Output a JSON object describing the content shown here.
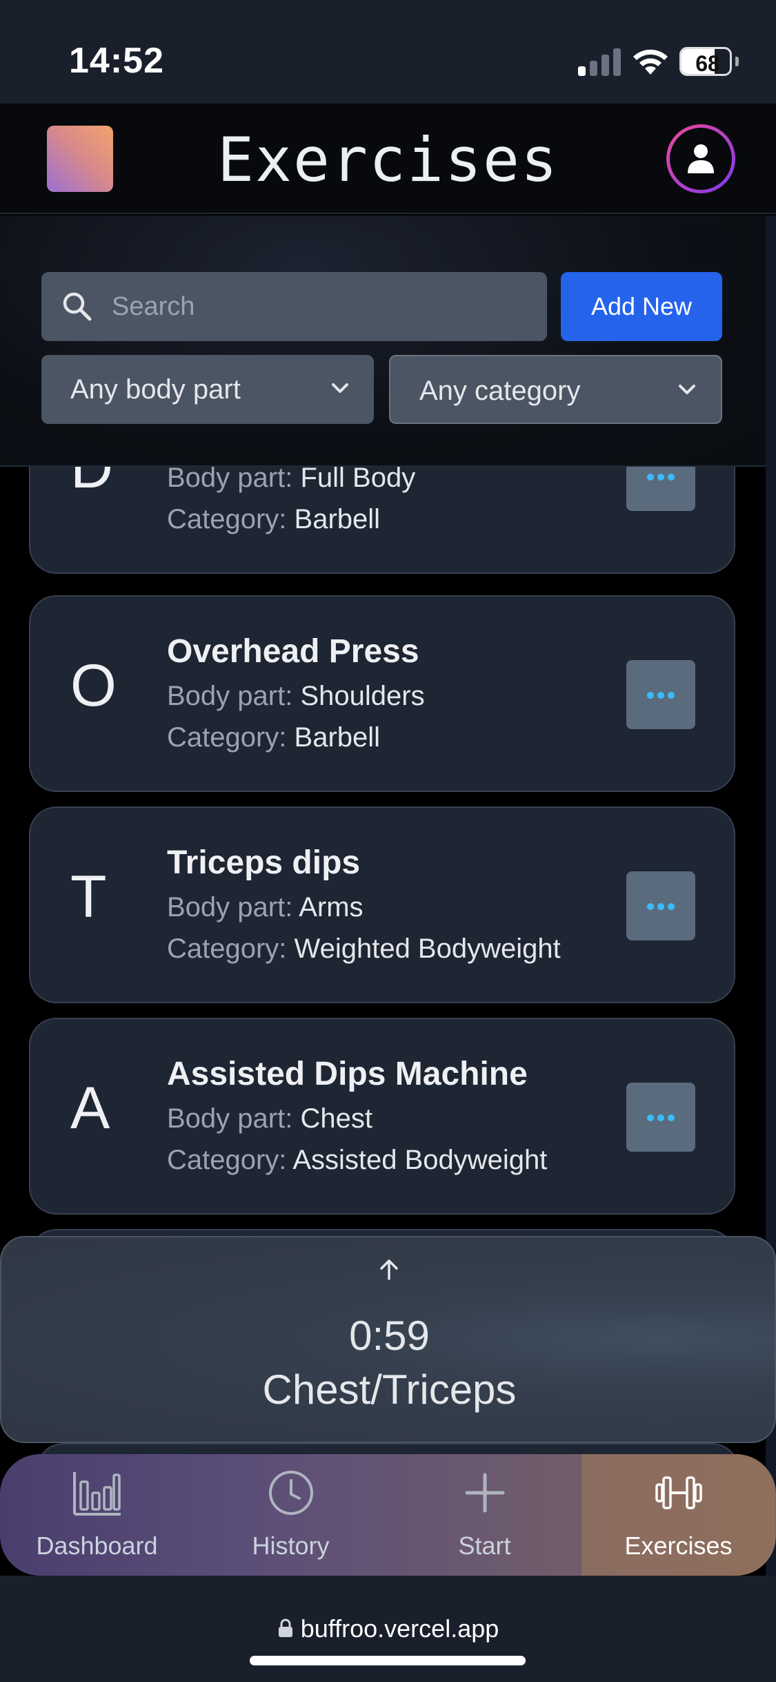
{
  "status_bar": {
    "time": "14:52",
    "battery": "68",
    "battery_level": 0.68,
    "signal_bars_active": 1
  },
  "header": {
    "title": "Exercises"
  },
  "controls": {
    "search_placeholder": "Search",
    "add_button": "Add New",
    "body_part_select": "Any body part",
    "category_select": "Any category"
  },
  "exercises": [
    {
      "letter": "D",
      "name": "",
      "body_part_label": "Body part:",
      "body_part": "Full Body",
      "category_label": "Category:",
      "category": "Barbell"
    },
    {
      "letter": "O",
      "name": "Overhead Press",
      "body_part_label": "Body part:",
      "body_part": "Shoulders",
      "category_label": "Category:",
      "category": "Barbell"
    },
    {
      "letter": "T",
      "name": "Triceps dips",
      "body_part_label": "Body part:",
      "body_part": "Arms",
      "category_label": "Category:",
      "category": "Weighted Bodyweight"
    },
    {
      "letter": "A",
      "name": "Assisted Dips Machine",
      "body_part_label": "Body part:",
      "body_part": "Chest",
      "category_label": "Category:",
      "category": "Assisted Bodyweight"
    }
  ],
  "timer": {
    "icon": "arrow-up-icon",
    "time": "0:59",
    "workout": "Chest/Triceps"
  },
  "tabs": [
    {
      "label": "Dashboard",
      "icon": "bar-chart-icon",
      "active": false
    },
    {
      "label": "History",
      "icon": "clock-icon",
      "active": false
    },
    {
      "label": "Start",
      "icon": "plus-icon",
      "active": false
    },
    {
      "label": "Exercises",
      "icon": "dumbbell-icon",
      "active": true
    }
  ],
  "browser": {
    "url": "buffroo.vercel.app"
  },
  "colors": {
    "accent": "#2563eb",
    "card": "#1e2533",
    "more_dots": "#38bdf8"
  }
}
